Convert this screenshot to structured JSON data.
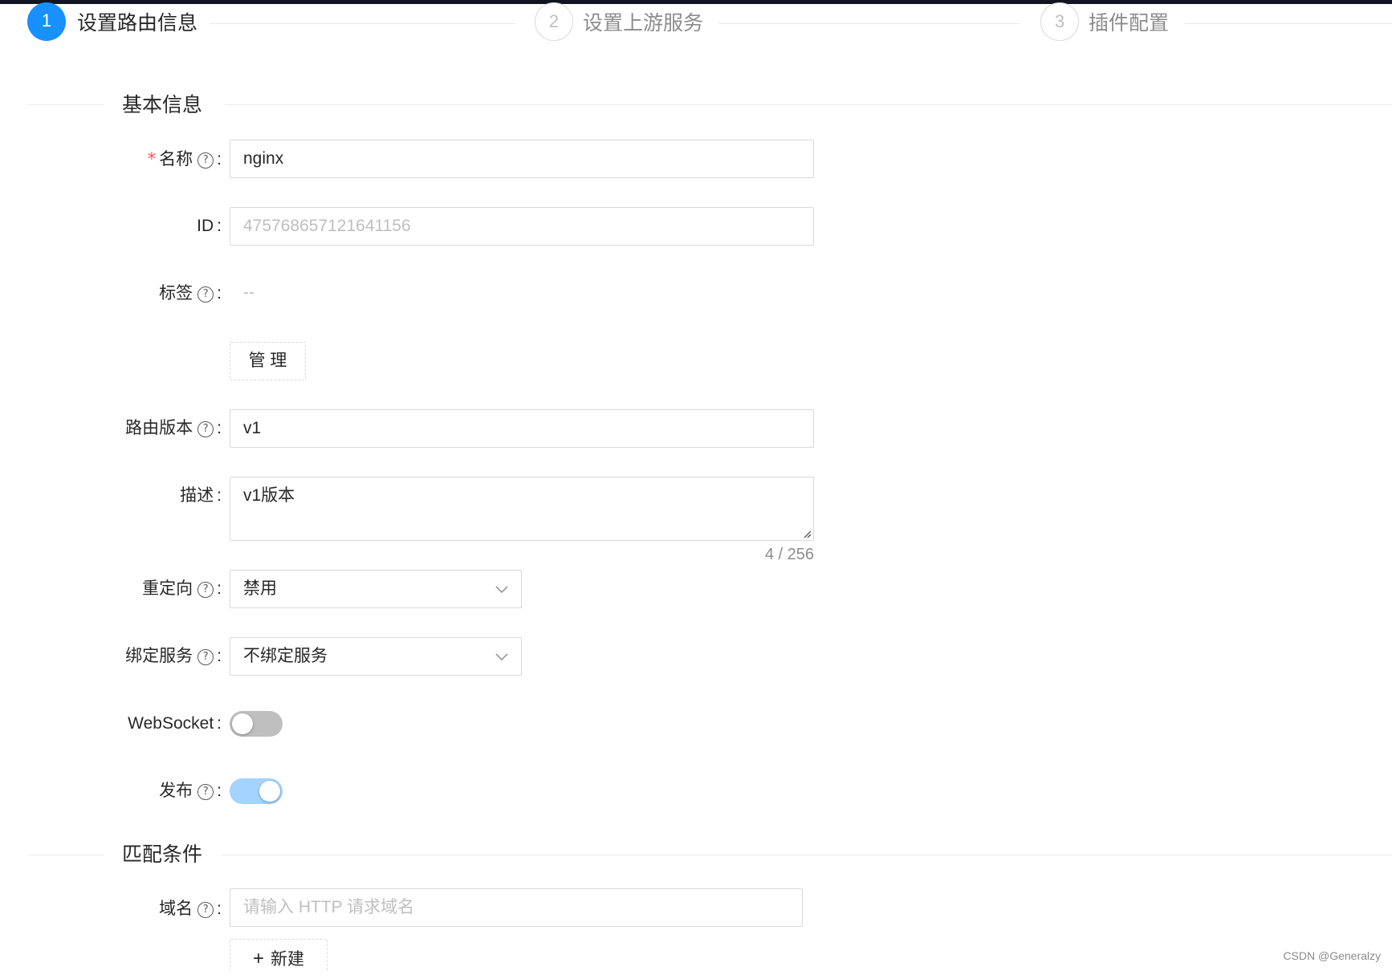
{
  "steps": [
    {
      "number": "1",
      "title": "设置路由信息",
      "status": "active"
    },
    {
      "number": "2",
      "title": "设置上游服务",
      "status": "wait"
    },
    {
      "number": "3",
      "title": "插件配置",
      "status": "wait"
    }
  ],
  "sections": {
    "basic_info": "基本信息",
    "match_conditions": "匹配条件"
  },
  "form": {
    "name": {
      "label": "名称",
      "required_mark": "*",
      "value": "nginx"
    },
    "id": {
      "label": "ID",
      "placeholder": "475768657121641156"
    },
    "tags": {
      "label": "标签",
      "value": "--",
      "manage_button": "管 理"
    },
    "route_version": {
      "label": "路由版本",
      "value": "v1"
    },
    "description": {
      "label": "描述",
      "value": "v1版本",
      "count": "4 / 256"
    },
    "redirect": {
      "label": "重定向",
      "value": "禁用"
    },
    "bind_service": {
      "label": "绑定服务",
      "value": "不绑定服务"
    },
    "websocket": {
      "label": "WebSocket",
      "enabled": false
    },
    "publish": {
      "label": "发布",
      "enabled": true
    },
    "domain": {
      "label": "域名",
      "placeholder": "请输入 HTTP 请求域名",
      "add_button": "新建",
      "add_icon": "+"
    }
  },
  "help_icon_glyph": "?",
  "colon": ":",
  "watermark": "CSDN @Generalzy",
  "colors": {
    "primary": "#1890ff",
    "switch_on": "#a3d3ff",
    "switch_off": "#bfbfbf",
    "required": "#ff4d4f"
  }
}
